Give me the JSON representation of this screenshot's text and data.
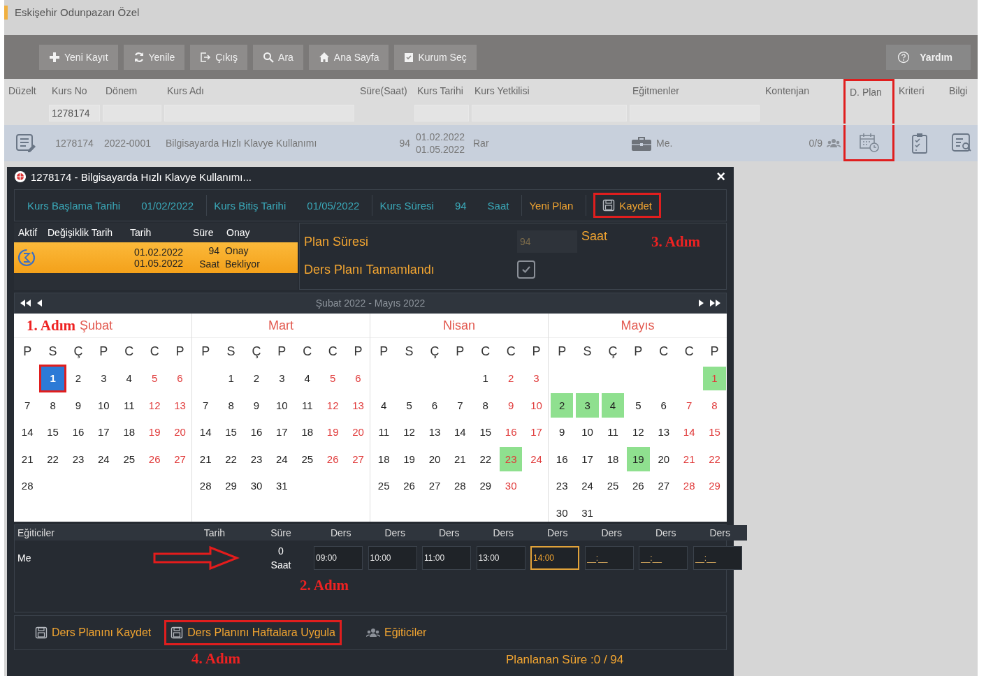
{
  "header": {
    "title": "Eskişehir Odunpazarı Özel"
  },
  "toolbar": {
    "buttons": [
      {
        "label": "Yeni Kayıt",
        "kind": "plus"
      },
      {
        "label": "Yenile",
        "kind": "refresh"
      },
      {
        "label": "Çıkış",
        "kind": "exit"
      },
      {
        "label": "Ara",
        "kind": "search"
      },
      {
        "label": "Ana Sayfa",
        "kind": "home"
      },
      {
        "label": "Kurum Seç",
        "kind": "clipboard"
      }
    ],
    "help": {
      "label": "Yardım"
    }
  },
  "grid": {
    "columns": [
      {
        "label": "Düzelt",
        "filter": false,
        "highlighted": false
      },
      {
        "label": "Kurs No",
        "filter": true,
        "value": "1278174",
        "highlighted": false
      },
      {
        "label": "Dönem",
        "filter": true,
        "highlighted": false
      },
      {
        "label": "Kurs Adı",
        "filter": true,
        "highlighted": false
      },
      {
        "label": "Süre(Saat)",
        "filter": false,
        "highlighted": false
      },
      {
        "label": "Kurs Tarihi",
        "filter": true,
        "highlighted": false
      },
      {
        "label": "Kurs Yetkilisi",
        "filter": true,
        "highlighted": false
      },
      {
        "label": "Eğitmenler",
        "filter": true,
        "highlighted": false
      },
      {
        "label": "Kontenjan",
        "filter": false,
        "highlighted": false
      },
      {
        "label": "D. Plan",
        "filter": false,
        "highlighted": true
      },
      {
        "label": "Kriteri",
        "filter": false,
        "highlighted": false
      },
      {
        "label": "Bilgi",
        "filter": false,
        "highlighted": false
      }
    ],
    "row": {
      "selected": true,
      "kurs_no": "1278174",
      "donem": "2022-0001",
      "kurs_adi": "Bilgisayarda Hızlı Klavye Kullanımı",
      "sure": "94",
      "start": "01.02.2022",
      "end": "01.05.2022",
      "yetkili": "Rar",
      "egitmen": "Me.",
      "kontenjan": "0/9"
    }
  },
  "dialog": {
    "title": "1278174 - Bilgisayarda Hızlı Klavye Kullanımı...",
    "close": "×",
    "info": [
      {
        "label": "Kurs Başlama Tarihi",
        "value": "01/02/2022"
      },
      {
        "label": "Kurs Bitiş Tarihi",
        "value": "01/05/2022"
      },
      {
        "label": "Kurs Süresi",
        "value": "94",
        "unit": "Saat"
      }
    ],
    "new_plan": "Yeni Plan",
    "save": {
      "label": "Kaydet",
      "highlighted": true
    },
    "plans": {
      "columns": [
        "Aktif",
        "Değişiklik Tarih",
        "Tarih",
        "Süre",
        "Onay"
      ],
      "rows": [
        {
          "selected": true,
          "start": "01.02.2022",
          "end": "01.05.2022",
          "duration": "94 Saat",
          "status": "Onay Bekliyor"
        }
      ]
    },
    "plan": {
      "label": "Plan Süresi",
      "value": "94",
      "unit": "Saat",
      "step": "3. Adım",
      "completed_label": "Ders Planı Tamamlandı",
      "completed": true
    },
    "calendar": {
      "range": "Şubat 2022 - Mayıs 2022",
      "months": [
        {
          "name": "Şubat",
          "step": "1. Adım",
          "weekdays": [
            "P",
            "S",
            "Ç",
            "P",
            "C",
            "C",
            "P"
          ],
          "weeks": [
            [
              {
                "d": "1",
                "marked": false,
                "selected": true
              },
              {
                "d": "2",
                "marked": false,
                "selected": false
              },
              {
                "d": "3",
                "marked": false,
                "selected": false
              },
              {
                "d": "4",
                "marked": false,
                "selected": false
              },
              {
                "d": "5",
                "marked": false,
                "selected": false
              },
              {
                "d": "6",
                "marked": false,
                "selected": false
              }
            ],
            [
              {
                "d": "7",
                "marked": false,
                "selected": false
              },
              {
                "d": "8",
                "marked": false,
                "selected": false
              },
              {
                "d": "9",
                "marked": false,
                "selected": false
              },
              {
                "d": "10",
                "marked": false,
                "selected": false
              },
              {
                "d": "11",
                "marked": false,
                "selected": false
              },
              {
                "d": "12",
                "marked": false,
                "selected": false
              },
              {
                "d": "13",
                "marked": false,
                "selected": false
              }
            ],
            [
              {
                "d": "14",
                "marked": false,
                "selected": false
              },
              {
                "d": "15",
                "marked": false,
                "selected": false
              },
              {
                "d": "16",
                "marked": false,
                "selected": false
              },
              {
                "d": "17",
                "marked": false,
                "selected": false
              },
              {
                "d": "18",
                "marked": false,
                "selected": false
              },
              {
                "d": "19",
                "marked": false,
                "selected": false
              },
              {
                "d": "20",
                "marked": false,
                "selected": false
              }
            ],
            [
              {
                "d": "21",
                "marked": false,
                "selected": false
              },
              {
                "d": "22",
                "marked": false,
                "selected": false
              },
              {
                "d": "23",
                "marked": false,
                "selected": false
              },
              {
                "d": "24",
                "marked": false,
                "selected": false
              },
              {
                "d": "25",
                "marked": false,
                "selected": false
              },
              {
                "d": "26",
                "marked": false,
                "selected": false
              },
              {
                "d": "27",
                "marked": false,
                "selected": false
              }
            ],
            [
              {
                "d": "28",
                "marked": false,
                "selected": false
              }
            ]
          ]
        },
        {
          "name": "Mart",
          "weekdays": [
            "P",
            "S",
            "Ç",
            "P",
            "C",
            "C",
            "P"
          ],
          "weeks": [
            [
              {
                "d": "1",
                "marked": false,
                "selected": false
              },
              {
                "d": "2",
                "marked": false,
                "selected": false
              },
              {
                "d": "3",
                "marked": false,
                "selected": false
              },
              {
                "d": "4",
                "marked": false,
                "selected": false
              },
              {
                "d": "5",
                "marked": false,
                "selected": false
              },
              {
                "d": "6",
                "marked": false,
                "selected": false
              }
            ],
            [
              {
                "d": "7",
                "marked": false,
                "selected": false
              },
              {
                "d": "8",
                "marked": false,
                "selected": false
              },
              {
                "d": "9",
                "marked": false,
                "selected": false
              },
              {
                "d": "10",
                "marked": false,
                "selected": false
              },
              {
                "d": "11",
                "marked": false,
                "selected": false
              },
              {
                "d": "12",
                "marked": false,
                "selected": false
              },
              {
                "d": "13",
                "marked": false,
                "selected": false
              }
            ],
            [
              {
                "d": "14",
                "marked": false,
                "selected": false
              },
              {
                "d": "15",
                "marked": false,
                "selected": false
              },
              {
                "d": "16",
                "marked": false,
                "selected": false
              },
              {
                "d": "17",
                "marked": false,
                "selected": false
              },
              {
                "d": "18",
                "marked": false,
                "selected": false
              },
              {
                "d": "19",
                "marked": false,
                "selected": false
              },
              {
                "d": "20",
                "marked": false,
                "selected": false
              }
            ],
            [
              {
                "d": "21",
                "marked": false,
                "selected": false
              },
              {
                "d": "22",
                "marked": false,
                "selected": false
              },
              {
                "d": "23",
                "marked": false,
                "selected": false
              },
              {
                "d": "24",
                "marked": false,
                "selected": false
              },
              {
                "d": "25",
                "marked": false,
                "selected": false
              },
              {
                "d": "26",
                "marked": false,
                "selected": false
              },
              {
                "d": "27",
                "marked": false,
                "selected": false
              }
            ],
            [
              {
                "d": "28",
                "marked": false,
                "selected": false
              },
              {
                "d": "29",
                "marked": false,
                "selected": false
              },
              {
                "d": "30",
                "marked": false,
                "selected": false
              },
              {
                "d": "31",
                "marked": false,
                "selected": false
              }
            ]
          ]
        },
        {
          "name": "Nisan",
          "weekdays": [
            "P",
            "S",
            "Ç",
            "P",
            "C",
            "C",
            "P"
          ],
          "weeks": [
            [
              {
                "d": "1",
                "marked": false,
                "selected": false
              },
              {
                "d": "2",
                "marked": false,
                "selected": false
              },
              {
                "d": "3",
                "marked": false,
                "selected": false
              }
            ],
            [
              {
                "d": "4",
                "marked": false,
                "selected": false
              },
              {
                "d": "5",
                "marked": false,
                "selected": false
              },
              {
                "d": "6",
                "marked": false,
                "selected": false
              },
              {
                "d": "7",
                "marked": false,
                "selected": false
              },
              {
                "d": "8",
                "marked": false,
                "selected": false
              },
              {
                "d": "9",
                "marked": false,
                "selected": false
              },
              {
                "d": "10",
                "marked": false,
                "selected": false
              }
            ],
            [
              {
                "d": "11",
                "marked": false,
                "selected": false
              },
              {
                "d": "12",
                "marked": false,
                "selected": false
              },
              {
                "d": "13",
                "marked": false,
                "selected": false
              },
              {
                "d": "14",
                "marked": false,
                "selected": false
              },
              {
                "d": "15",
                "marked": false,
                "selected": false
              },
              {
                "d": "16",
                "marked": false,
                "selected": false
              },
              {
                "d": "17",
                "marked": false,
                "selected": false
              }
            ],
            [
              {
                "d": "18",
                "marked": false,
                "selected": false
              },
              {
                "d": "19",
                "marked": false,
                "selected": false
              },
              {
                "d": "20",
                "marked": false,
                "selected": false
              },
              {
                "d": "21",
                "marked": false,
                "selected": false
              },
              {
                "d": "22",
                "marked": false,
                "selected": false
              },
              {
                "d": "23",
                "marked": true,
                "selected": false
              },
              {
                "d": "24",
                "marked": false,
                "selected": false
              }
            ],
            [
              {
                "d": "25",
                "marked": false,
                "selected": false
              },
              {
                "d": "26",
                "marked": false,
                "selected": false
              },
              {
                "d": "27",
                "marked": false,
                "selected": false
              },
              {
                "d": "28",
                "marked": false,
                "selected": false
              },
              {
                "d": "29",
                "marked": false,
                "selected": false
              },
              {
                "d": "30",
                "marked": false,
                "selected": false
              }
            ]
          ]
        },
        {
          "name": "Mayıs",
          "weekdays": [
            "P",
            "S",
            "Ç",
            "P",
            "C",
            "C",
            "P"
          ],
          "weeks": [
            [
              {
                "d": "1",
                "marked": true,
                "selected": false
              }
            ],
            [
              {
                "d": "2",
                "marked": true,
                "selected": false
              },
              {
                "d": "3",
                "marked": true,
                "selected": false
              },
              {
                "d": "4",
                "marked": true,
                "selected": false
              },
              {
                "d": "5",
                "marked": false,
                "selected": false
              },
              {
                "d": "6",
                "marked": false,
                "selected": false
              },
              {
                "d": "7",
                "marked": false,
                "selected": false
              },
              {
                "d": "8",
                "marked": false,
                "selected": false
              }
            ],
            [
              {
                "d": "9",
                "marked": false,
                "selected": false
              },
              {
                "d": "10",
                "marked": false,
                "selected": false
              },
              {
                "d": "11",
                "marked": false,
                "selected": false
              },
              {
                "d": "12",
                "marked": false,
                "selected": false
              },
              {
                "d": "13",
                "marked": false,
                "selected": false
              },
              {
                "d": "14",
                "marked": false,
                "selected": false
              },
              {
                "d": "15",
                "marked": false,
                "selected": false
              }
            ],
            [
              {
                "d": "16",
                "marked": false,
                "selected": false
              },
              {
                "d": "17",
                "marked": false,
                "selected": false
              },
              {
                "d": "18",
                "marked": false,
                "selected": false
              },
              {
                "d": "19",
                "marked": true,
                "selected": false
              },
              {
                "d": "20",
                "marked": false,
                "selected": false
              },
              {
                "d": "21",
                "marked": false,
                "selected": false
              },
              {
                "d": "22",
                "marked": false,
                "selected": false
              }
            ],
            [
              {
                "d": "23",
                "marked": false,
                "selected": false
              },
              {
                "d": "24",
                "marked": false,
                "selected": false
              },
              {
                "d": "25",
                "marked": false,
                "selected": false
              },
              {
                "d": "26",
                "marked": false,
                "selected": false
              },
              {
                "d": "27",
                "marked": false,
                "selected": false
              },
              {
                "d": "28",
                "marked": false,
                "selected": false
              },
              {
                "d": "29",
                "marked": false,
                "selected": false
              }
            ],
            [
              {
                "d": "30",
                "marked": false,
                "selected": false
              },
              {
                "d": "31",
                "marked": false,
                "selected": false
              }
            ]
          ]
        }
      ]
    },
    "lessons": {
      "columns": [
        "Eğiticiler",
        "Tarih",
        "Süre",
        "Ders",
        "Ders",
        "Ders",
        "Ders",
        "Ders",
        "Ders",
        "Ders",
        "Ders"
      ],
      "rows": [
        {
          "trainer": "Me",
          "duration": "0 Saat",
          "times": [
            {
              "value": "09:00",
              "focused": false
            },
            {
              "value": "10:00",
              "focused": false
            },
            {
              "value": "11:00",
              "focused": false
            },
            {
              "value": "13:00",
              "focused": false
            },
            {
              "value": "14:00",
              "focused": true
            },
            {
              "placeholder": "__:__",
              "focused": false
            },
            {
              "placeholder": "__:__",
              "focused": false
            },
            {
              "placeholder": "__:__",
              "focused": false
            }
          ]
        }
      ],
      "step": "2. Adım"
    },
    "actions": [
      {
        "label": "Ders Planını Kaydet",
        "kind": "save",
        "highlighted": false
      },
      {
        "label": "Ders Planını Haftalara Uygula",
        "kind": "save",
        "highlighted": true
      },
      {
        "label": "Eğiticiler",
        "kind": "people",
        "highlighted": false
      }
    ],
    "actions_step": "4. Adım",
    "total": "Planlanan Süre :0 / 94"
  }
}
